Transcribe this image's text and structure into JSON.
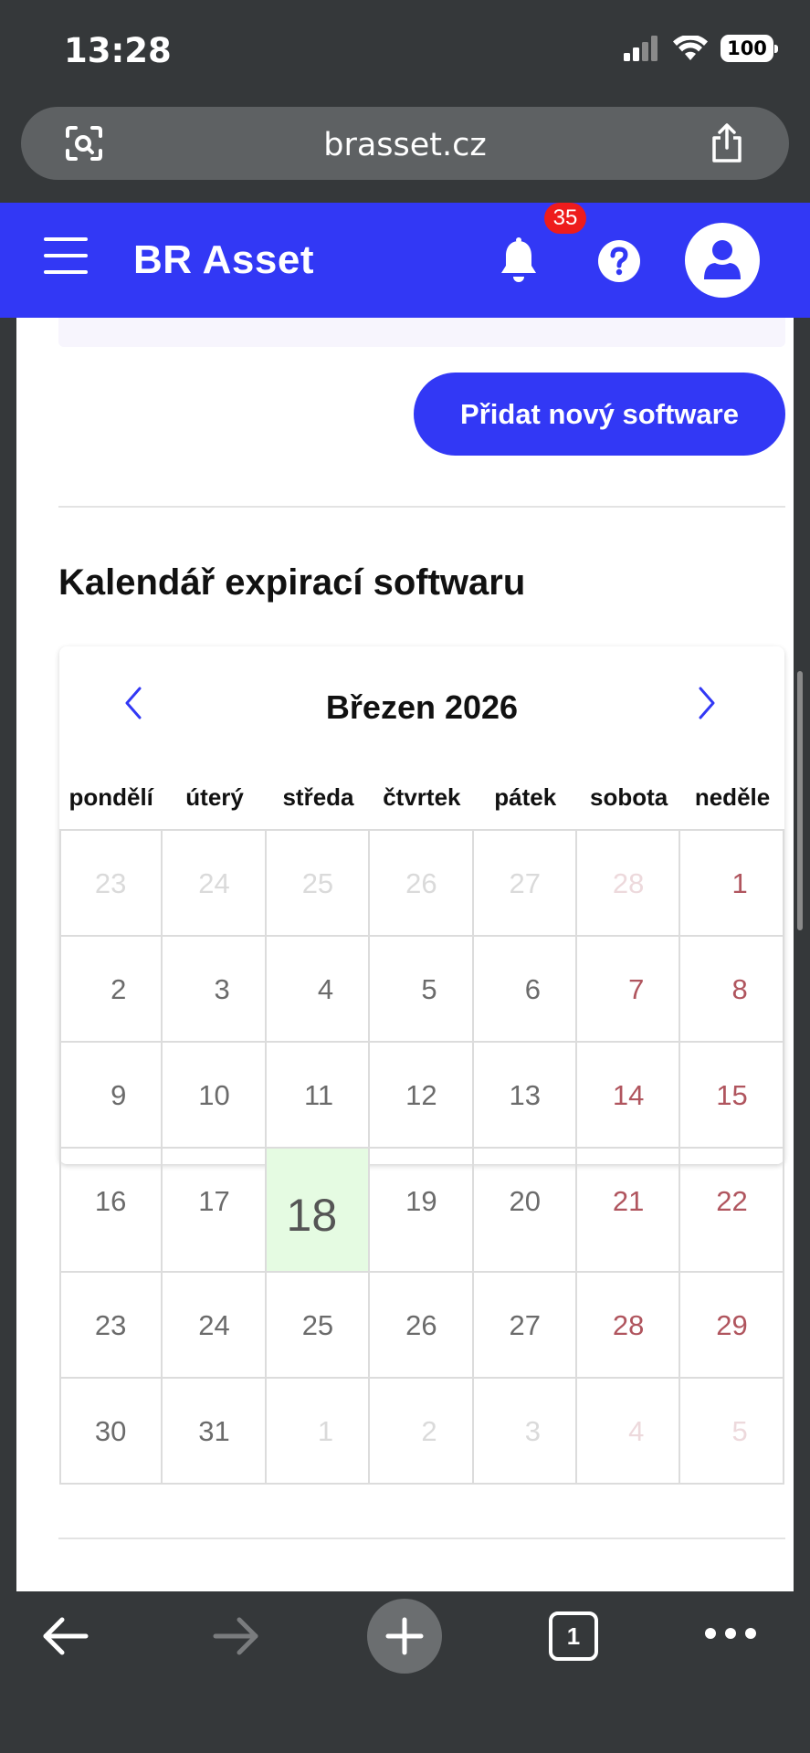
{
  "status": {
    "time": "13:28",
    "battery": "100"
  },
  "browser": {
    "url": "brasset.cz",
    "tab_count": "1"
  },
  "app": {
    "title": "BR Asset",
    "notification_count": "35"
  },
  "actions": {
    "add_software": "Přidat nový software"
  },
  "section": {
    "title": "Kalendář expirací softwaru"
  },
  "calendar": {
    "month_label": "Březen 2026",
    "weekdays": [
      "pondělí",
      "úterý",
      "středa",
      "čtvrtek",
      "pátek",
      "sobota",
      "neděle"
    ],
    "weeks": [
      [
        "23",
        "24",
        "25",
        "26",
        "27",
        "28",
        "1"
      ],
      [
        "2",
        "3",
        "4",
        "5",
        "6",
        "7",
        "8"
      ],
      [
        "9",
        "10",
        "11",
        "12",
        "13",
        "14",
        "15"
      ],
      [
        "16",
        "17",
        "18",
        "19",
        "20",
        "21",
        "22"
      ],
      [
        "23",
        "24",
        "25",
        "26",
        "27",
        "28",
        "29"
      ],
      [
        "30",
        "31",
        "1",
        "2",
        "3",
        "4",
        "5"
      ]
    ],
    "today": "18"
  },
  "colors": {
    "brand": "#3238f5",
    "badge": "#ee1c1c",
    "today_bg": "#e5fbe2",
    "weekend_text": "#b0555e"
  },
  "icons": {
    "menu": "hamburger-icon",
    "notifications": "bell-icon",
    "help": "help-icon",
    "profile": "user-icon",
    "prev": "chevron-left-icon",
    "next": "chevron-right-icon"
  }
}
